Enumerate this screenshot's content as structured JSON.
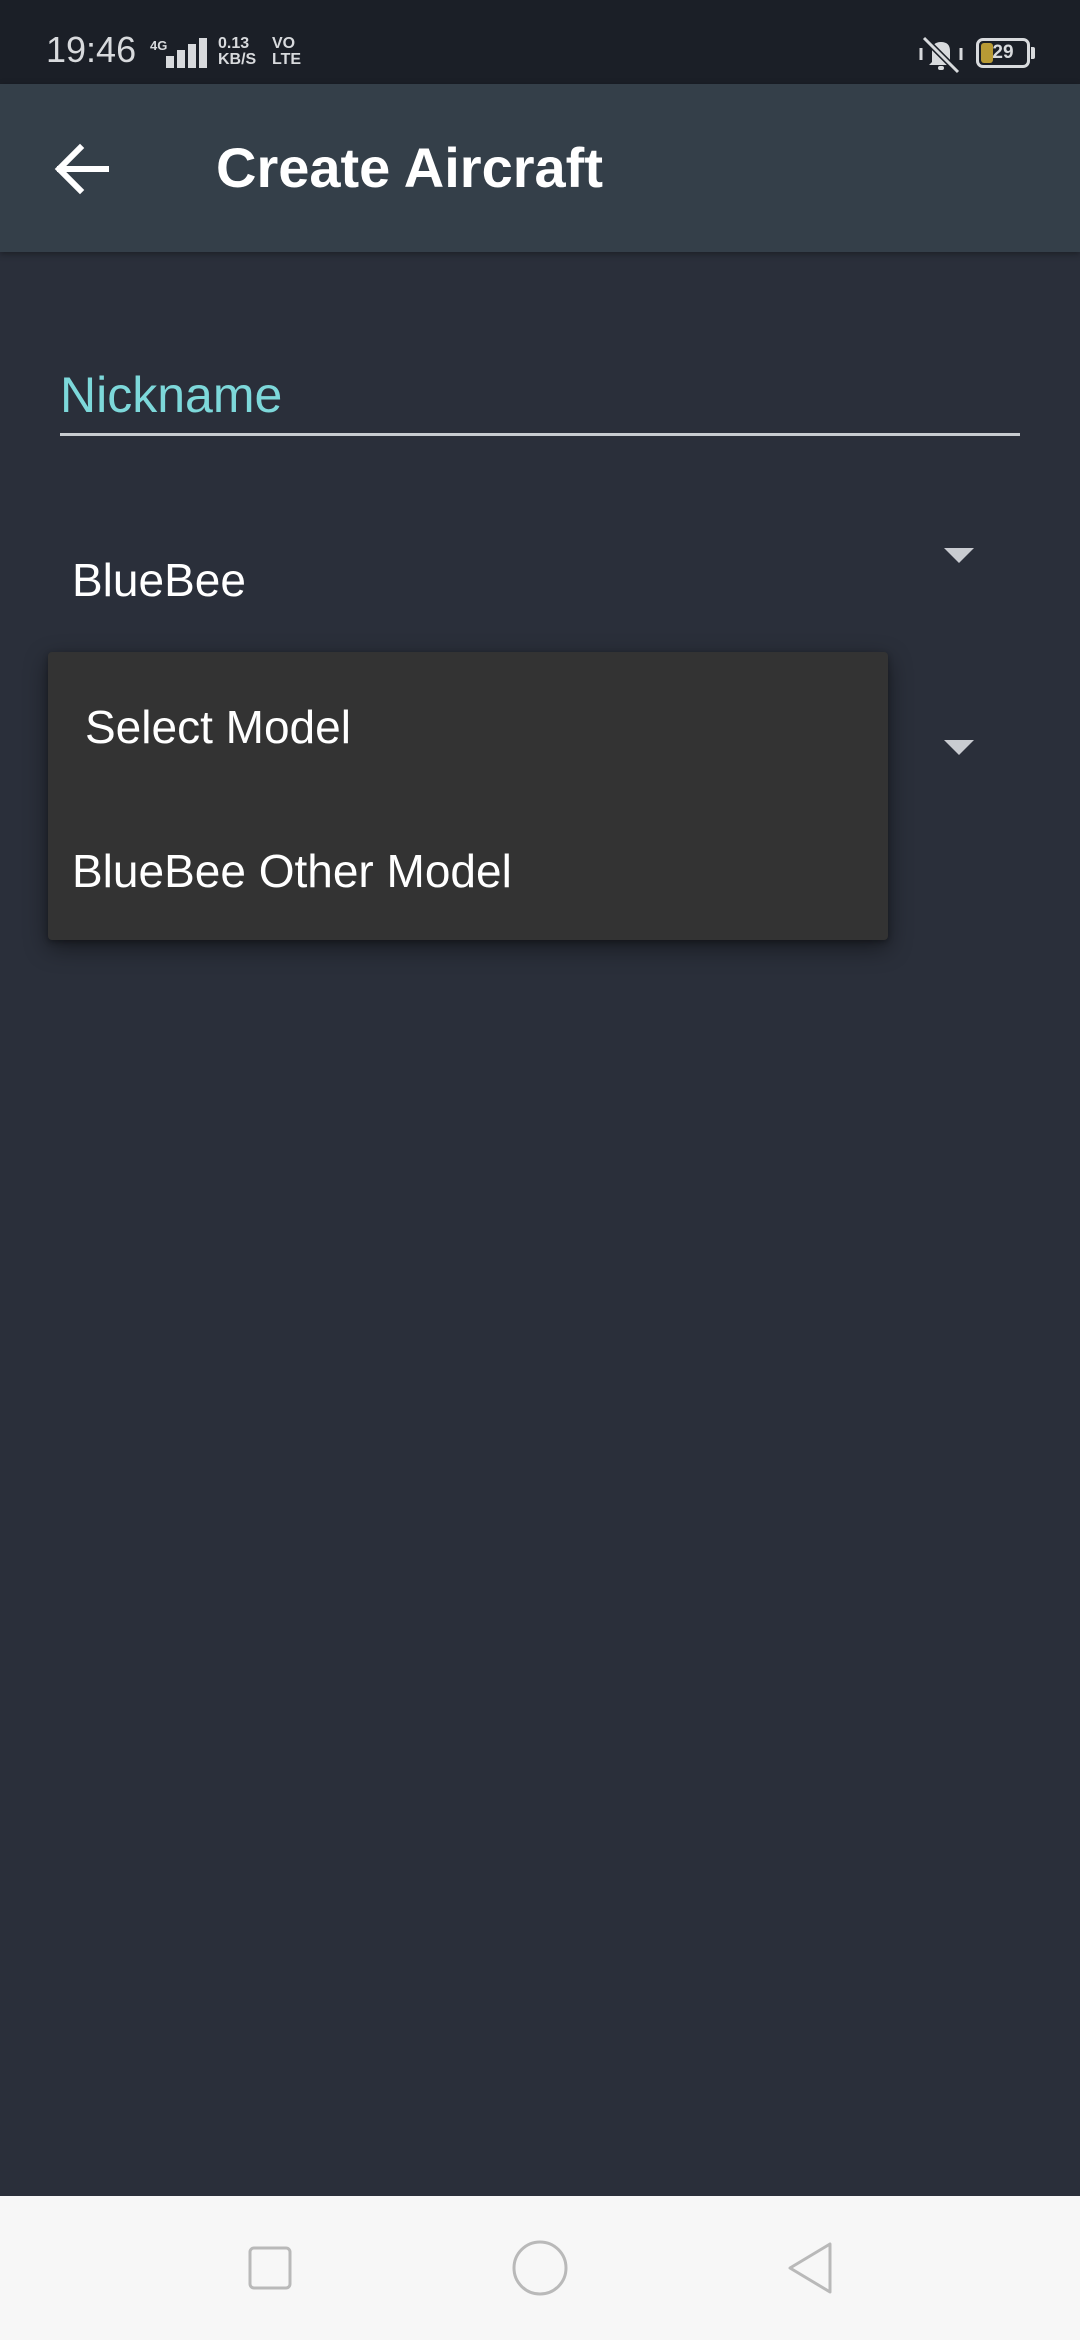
{
  "status_bar": {
    "time": "19:46",
    "network": "4G",
    "speed_value": "0.13",
    "speed_unit": "KB/S",
    "volte_top": "VO",
    "volte_bottom": "LTE",
    "battery": "29"
  },
  "app_bar": {
    "title": "Create Aircraft",
    "back_icon": "arrow-left-icon"
  },
  "form": {
    "nickname_placeholder": "Nickname",
    "nickname_value": "",
    "make_value": "BlueBee"
  },
  "dropdown": {
    "options": [
      {
        "label": "Select Model"
      },
      {
        "label": "BlueBee Other Model"
      }
    ]
  },
  "colors": {
    "background": "#2a2f3a",
    "app_bar": "#343f49",
    "accent": "#7dd8da",
    "menu": "#333333"
  }
}
